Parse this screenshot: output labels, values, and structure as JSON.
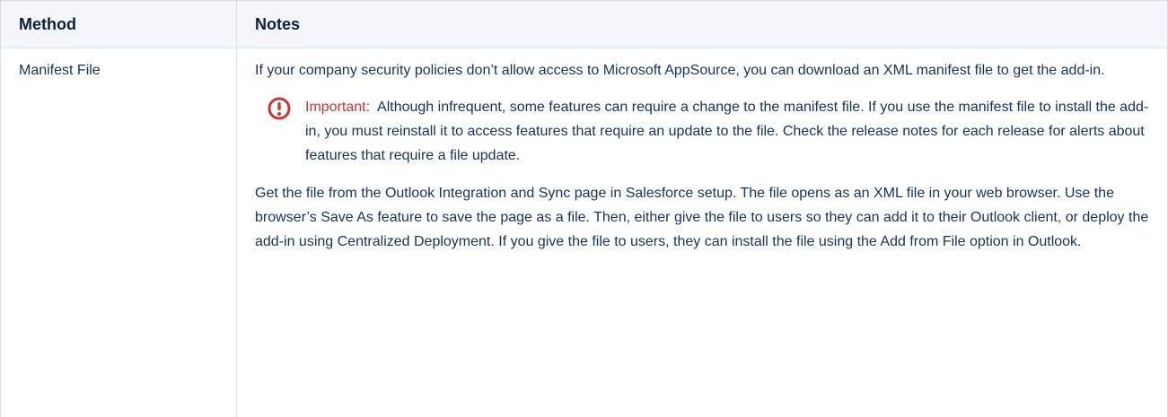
{
  "table": {
    "headers": {
      "method": "Method",
      "notes": "Notes"
    },
    "row": {
      "method": "Manifest File",
      "intro": "If your company security policies don’t allow access to Microsoft AppSource, you can download an XML manifest file to get the add-in.",
      "important": {
        "label": "Important:",
        "text": "Although infrequent, some features can require a change to the manifest file. If you use the manifest file to install the add-in, you must reinstall it to access features that require an update to the file. Check the release notes for each release for alerts about features that require a file update."
      },
      "details": "Get the file from the Outlook Integration and Sync page in Salesforce setup. The file opens as an XML file in your web browser. Use the browser’s Save As feature to save the page as a file. Then, either give the file to users so they can add it to their Outlook client, or deploy the add-in using Centralized Deployment. If you give the file to users, they can install the file using the Add from File option in Outlook."
    }
  },
  "icons": {
    "important": "warning-circle-icon"
  },
  "colors": {
    "important_accent": "#c23934",
    "header_background": "#f4f6f9",
    "border": "#d8dde6",
    "text": "#16325c"
  }
}
